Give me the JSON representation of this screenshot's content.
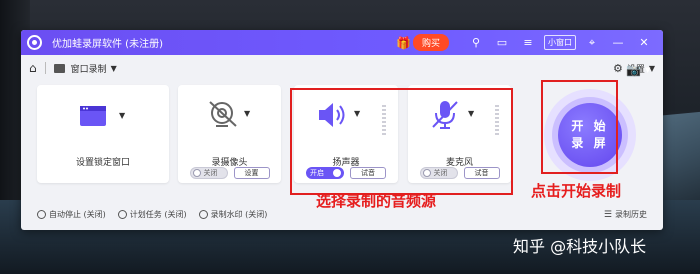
{
  "app": {
    "title": "优加蛙录屏软件 (未注册)",
    "buy_label": "购买",
    "mini_label": "小窗口"
  },
  "toolbar": {
    "mode_label": "窗口录制",
    "settings_label": "设置"
  },
  "cards": {
    "window": {
      "label": "设置锁定窗口"
    },
    "camera": {
      "label": "录摄像头",
      "toggle": "关闭",
      "button": "设置"
    },
    "speaker": {
      "label": "扬声器",
      "toggle": "开启",
      "button": "试音"
    },
    "mic": {
      "label": "麦克风",
      "toggle": "关闭",
      "button": "试音"
    }
  },
  "start_button": {
    "label": "开 始\n录 屏"
  },
  "footer": {
    "auto_stop": "自动停止 (关闭)",
    "schedule": "计划任务 (关闭)",
    "watermark": "录制水印 (关闭)",
    "history": "录制历史"
  },
  "annotations": {
    "audio_source": "选择录制的音频源",
    "click_start": "点击开始录制"
  },
  "watermark_text": "知乎 @科技小队长",
  "colors": {
    "accent": "#6a55f5",
    "buy": "#ff4a26",
    "annotation": "#e61e1e"
  }
}
